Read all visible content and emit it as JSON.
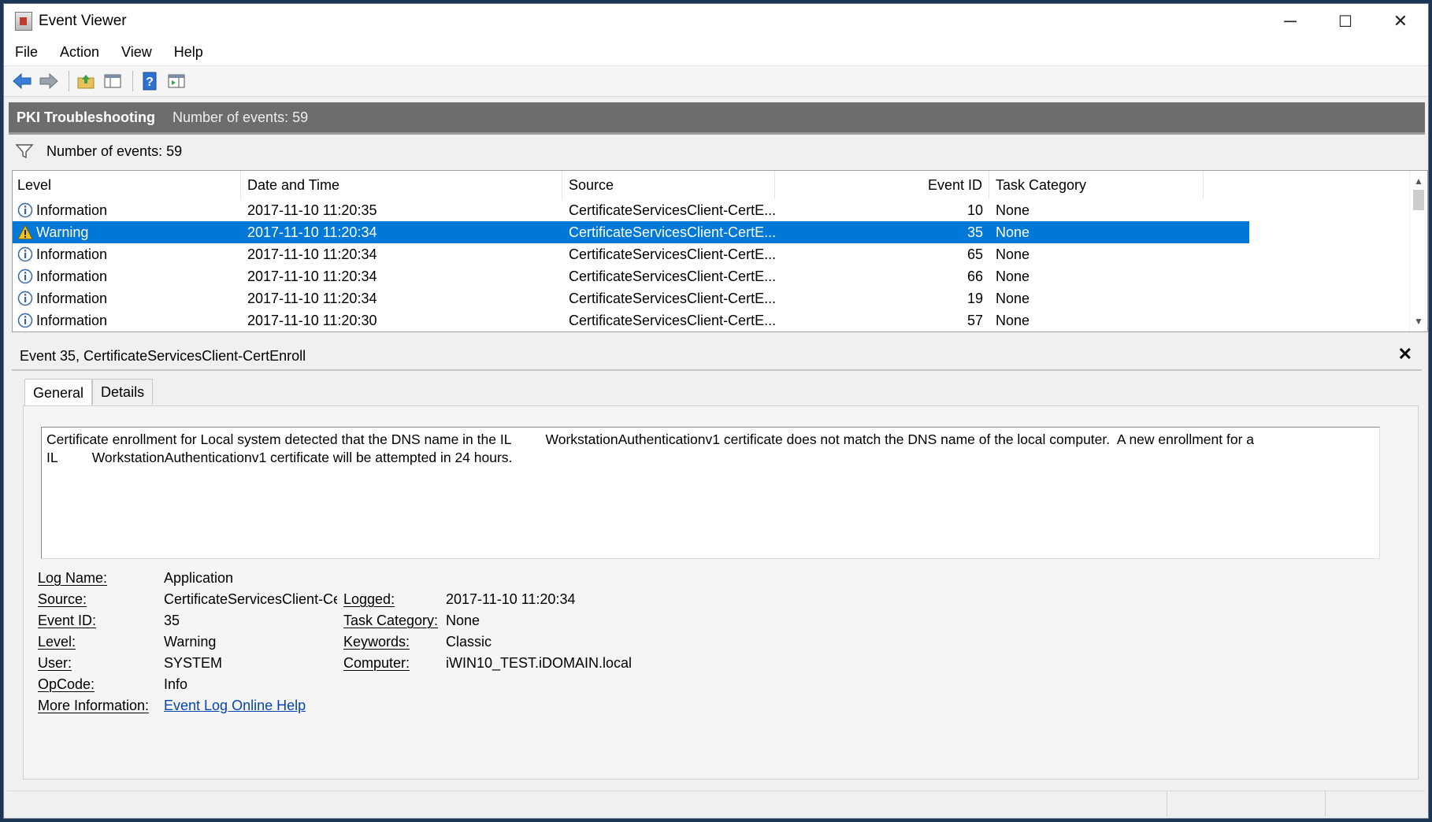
{
  "window": {
    "title": "Event Viewer",
    "min": "─",
    "max": "☐",
    "close": "✕"
  },
  "menu": [
    "File",
    "Action",
    "View",
    "Help"
  ],
  "header": {
    "title": "PKI Troubleshooting",
    "count": "Number of events: 59"
  },
  "filter": {
    "text": "Number of events: 59"
  },
  "grid": {
    "columns": [
      "Level",
      "Date and Time",
      "Source",
      "Event ID",
      "Task Category"
    ],
    "rows": [
      {
        "level": "Information",
        "date": "2017-11-10 11:20:35",
        "source": "CertificateServicesClient-CertE...",
        "id": "10",
        "category": "None"
      },
      {
        "level": "Warning",
        "date": "2017-11-10 11:20:34",
        "source": "CertificateServicesClient-CertE...",
        "id": "35",
        "category": "None"
      },
      {
        "level": "Information",
        "date": "2017-11-10 11:20:34",
        "source": "CertificateServicesClient-CertE...",
        "id": "65",
        "category": "None"
      },
      {
        "level": "Information",
        "date": "2017-11-10 11:20:34",
        "source": "CertificateServicesClient-CertE...",
        "id": "66",
        "category": "None"
      },
      {
        "level": "Information",
        "date": "2017-11-10 11:20:34",
        "source": "CertificateServicesClient-CertE...",
        "id": "19",
        "category": "None"
      },
      {
        "level": "Information",
        "date": "2017-11-10 11:20:30",
        "source": "CertificateServicesClient-CertE...",
        "id": "57",
        "category": "None"
      }
    ],
    "selected_row": 1
  },
  "detail": {
    "title": "Event 35, CertificateServicesClient-CertEnroll",
    "close": "✕",
    "tabs": [
      "General",
      "Details"
    ],
    "description_line1": "Certificate enrollment for Local system detected that the DNS name in the IL         WorkstationAuthenticationv1 certificate does not match the DNS name of the local computer.  A new enrollment for a",
    "description_line2": "IL         WorkstationAuthenticationv1 certificate will be attempted in 24 hours.",
    "log_name_label": "Log Name:",
    "log_name": "Application",
    "source_label": "Source:",
    "source": "CertificateServicesClient-Cer",
    "logged_label": "Logged:",
    "logged": "2017-11-10 11:20:34",
    "event_id_label": "Event ID:",
    "event_id": "35",
    "task_category_label": "Task Category:",
    "task_category": "None",
    "level_label": "Level:",
    "level": "Warning",
    "keywords_label": "Keywords:",
    "keywords": "Classic",
    "user_label": "User:",
    "user": "SYSTEM",
    "computer_label": "Computer:",
    "computer": "iWIN10_TEST.iDOMAIN.local",
    "opcode_label": "OpCode:",
    "opcode": "Info",
    "more_info_label": "More Information:",
    "more_info_link": "Event Log Online Help"
  },
  "colors": {
    "selection": "#0078d7",
    "header_band": "#6d6d6d",
    "link": "#0645ad"
  },
  "icons": [
    "back-arrow-icon",
    "forward-arrow-icon",
    "folder-up-icon",
    "show-hide-tree-icon",
    "help-icon",
    "show-hide-action-pane-icon",
    "filter-icon",
    "information-icon",
    "warning-icon"
  ]
}
